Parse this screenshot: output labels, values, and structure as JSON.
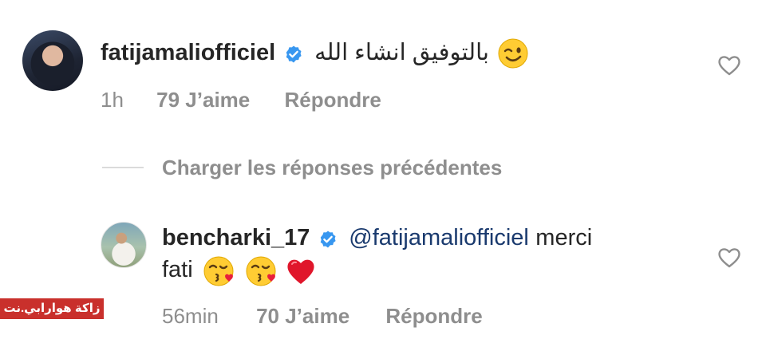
{
  "comments": [
    {
      "username": "fatijamaliofficiel",
      "text": "بالتوفيق انشاء الله",
      "emoji": "winking-face",
      "time": "1h",
      "likes": "79 J’aime",
      "reply": "Répondre"
    },
    {
      "username": "bencharki_17",
      "mention": "@fatijamaliofficiel",
      "text_line1": "merci",
      "text_line2": "fati",
      "emojis": [
        "kissing-face-heart",
        "kissing-face-heart",
        "red-heart"
      ],
      "time": "56min",
      "likes": "70 J’aime",
      "reply": "Répondre"
    }
  ],
  "load_more": "Charger les réponses précédentes",
  "watermark": "زاكة هوارابي.نت",
  "colors": {
    "verified": "#3897f0",
    "mention": "#1a3a6e",
    "muted": "#8e8e8e",
    "watermark_bg": "#c9302c"
  }
}
